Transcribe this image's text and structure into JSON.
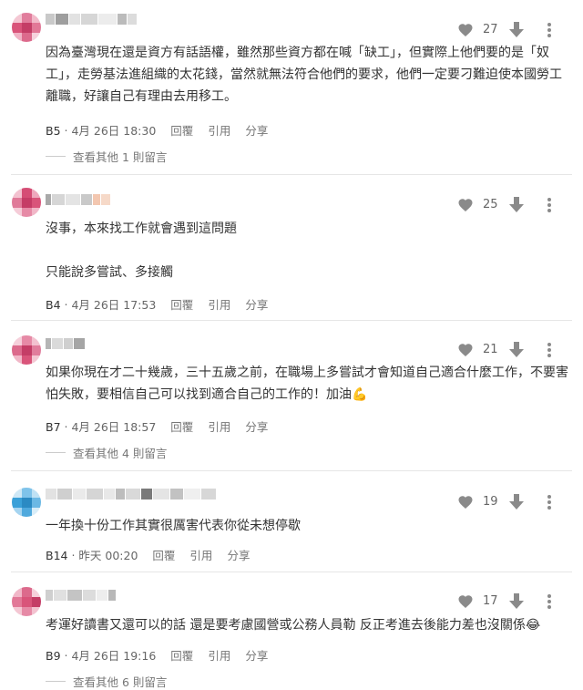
{
  "comments": [
    {
      "text": "因為臺灣現在還是資方有話語權，雖然那些資方都在喊「缺工」，但實際上他們要的是「奴工」，走勞基法進組織的太花錢，當然就無法符合他們的要求，他們一定要刁難迫使本國勞工離職，好讓自己有理由去用移工。",
      "likes": "27",
      "floor": "B5",
      "time": "4月 26日 18:30",
      "reply": "回覆",
      "quote": "引用",
      "share": "分享",
      "view_more": "查看其他 1 則留言"
    },
    {
      "text": "沒事，本來找工作就會遇到這問題\n\n只能說多嘗試、多接觸",
      "likes": "25",
      "floor": "B4",
      "time": "4月 26日 17:53",
      "reply": "回覆",
      "quote": "引用",
      "share": "分享"
    },
    {
      "text": "如果你現在才二十幾歲，三十五歲之前，在職場上多嘗試才會知道自己適合什麼工作，不要害怕失敗，要相信自己可以找到適合自己的工作的！加油💪",
      "likes": "21",
      "floor": "B7",
      "time": "4月 26日 18:57",
      "reply": "回覆",
      "quote": "引用",
      "share": "分享",
      "view_more": "查看其他 4 則留言"
    },
    {
      "text": "一年換十份工作其實很厲害代表你從未想停歇",
      "likes": "19",
      "floor": "B14",
      "time": "昨天 00:20",
      "reply": "回覆",
      "quote": "引用",
      "share": "分享"
    },
    {
      "text": "考運好讀書又還可以的話 還是要考慮國營或公務人員勒 反正考進去後能力差也沒關係😂",
      "likes": "17",
      "floor": "B9",
      "time": "4月 26日 19:16",
      "reply": "回覆",
      "quote": "引用",
      "share": "分享",
      "view_more": "查看其他 6 則留言"
    }
  ],
  "colors": {
    "icon": "#8a8a8a",
    "avatar_pink": "#d9547a",
    "avatar_blue": "#3aa0d8"
  }
}
